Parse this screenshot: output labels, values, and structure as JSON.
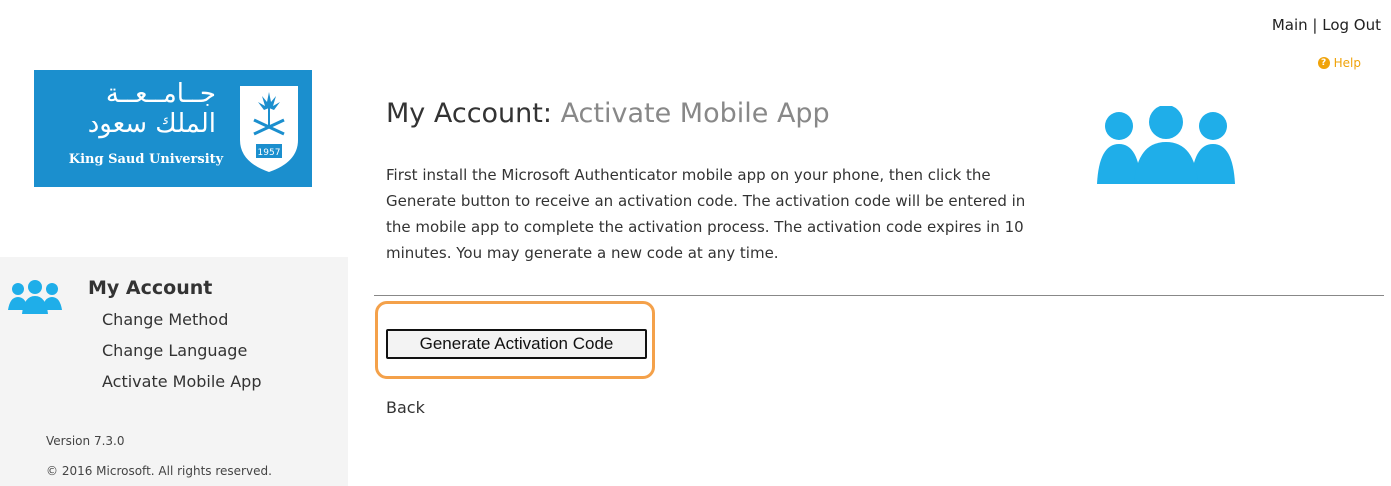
{
  "header": {
    "main_link": "Main",
    "separator": " | ",
    "logout_link": "Log Out",
    "help_label": "Help"
  },
  "logo": {
    "arabic_line1": "جــامــعــة",
    "arabic_line2": "الملك سعود",
    "english_name": "King Saud University",
    "seal_year": "1957"
  },
  "sidebar": {
    "title": "My Account",
    "items": [
      {
        "label": "Change Method"
      },
      {
        "label": "Change Language"
      },
      {
        "label": "Activate Mobile App"
      }
    ],
    "version": "Version 7.3.0",
    "copyright": "© 2016 Microsoft. All rights reserved."
  },
  "main": {
    "heading_prefix": "My Account: ",
    "heading_sub": "Activate Mobile App",
    "description": "First install the Microsoft Authenticator mobile app on your phone, then click the Generate button to receive an activation code. The activation code will be entered in the mobile app to complete the activation process. The activation code expires in 10 minutes. You may generate a new code at any time.",
    "generate_button": "Generate Activation Code",
    "back_link": "Back"
  },
  "colors": {
    "accent_blue": "#1faee9",
    "logo_blue": "#1b8fce",
    "help_orange": "#f0a30a",
    "highlight_orange": "#f4a14a"
  },
  "icons": {
    "help": "question-circle-icon",
    "users": "users-icon",
    "seal": "university-seal-icon"
  }
}
